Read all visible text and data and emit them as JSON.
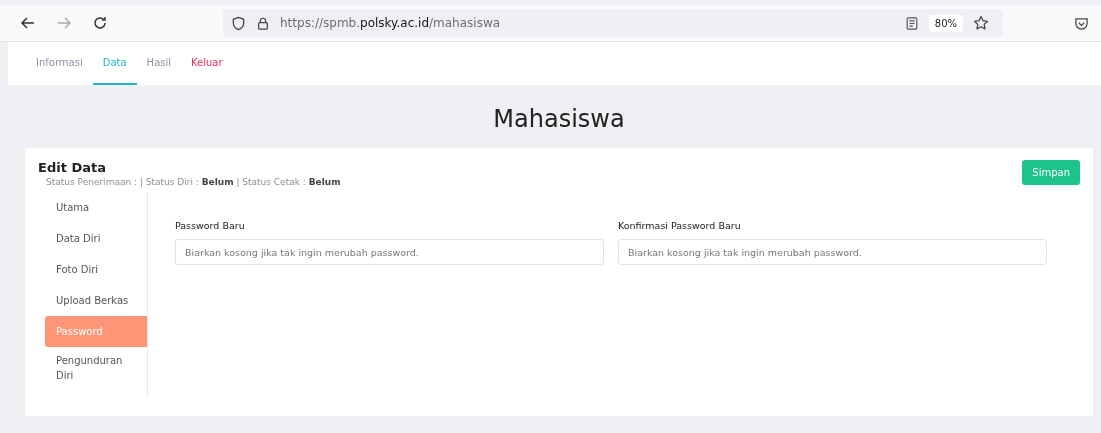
{
  "browser": {
    "url_prefix": "https://spmb.",
    "url_domain": "polsky.ac.id",
    "url_path": "/mahasiswa",
    "zoom": "80%"
  },
  "tabs": [
    {
      "label": "Informasi",
      "selected": false,
      "kind": "link"
    },
    {
      "label": "Data",
      "selected": true,
      "kind": "link"
    },
    {
      "label": "Hasil",
      "selected": false,
      "kind": "link"
    },
    {
      "label": "Keluar",
      "selected": false,
      "kind": "danger"
    }
  ],
  "page_title": "Mahasiswa",
  "card": {
    "title": "Edit Data",
    "status": "Status Penerimaan : | Status Diri : **Belum** | Status Cetak : **Belum**",
    "save_button": "Simpan"
  },
  "sidebar": {
    "items": [
      {
        "label": "Utama",
        "selected": false
      },
      {
        "label": "Data Diri",
        "selected": false
      },
      {
        "label": "Foto Diri",
        "selected": false
      },
      {
        "label": "Upload Berkas",
        "selected": false
      },
      {
        "label": "Password",
        "selected": true
      },
      {
        "label": "Pengunduran Diri",
        "selected": false
      }
    ]
  },
  "fields": [
    {
      "label": "Password Baru",
      "placeholder": "Biarkan kosong jika tak ingin merubah password."
    },
    {
      "label": "Konfirmasi Password Baru",
      "placeholder": "Biarkan kosong jika tak ingin merubah password."
    }
  ]
}
